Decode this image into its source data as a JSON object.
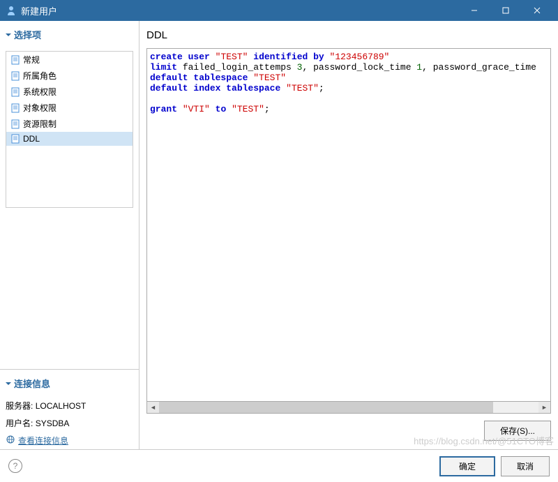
{
  "titlebar": {
    "title": "新建用户"
  },
  "sidebar": {
    "header": "选择项",
    "items": [
      {
        "label": "常规"
      },
      {
        "label": "所属角色"
      },
      {
        "label": "系统权限"
      },
      {
        "label": "对象权限"
      },
      {
        "label": "资源限制"
      },
      {
        "label": "DDL",
        "selected": true
      }
    ]
  },
  "connection": {
    "header": "连接信息",
    "server_label": "服务器:",
    "server_value": "LOCALHOST",
    "user_label": "用户名:",
    "user_value": "SYSDBA",
    "view_link": "查看连接信息"
  },
  "content": {
    "title": "DDL",
    "code_tokens": [
      {
        "t": "kw",
        "v": "create"
      },
      {
        "t": "",
        "v": " "
      },
      {
        "t": "kw",
        "v": "user"
      },
      {
        "t": "",
        "v": " "
      },
      {
        "t": "str",
        "v": "\"TEST\""
      },
      {
        "t": "",
        "v": " "
      },
      {
        "t": "kw",
        "v": "identified"
      },
      {
        "t": "",
        "v": " "
      },
      {
        "t": "kw",
        "v": "by"
      },
      {
        "t": "",
        "v": " "
      },
      {
        "t": "str",
        "v": "\"123456789\""
      },
      {
        "t": "nl",
        "v": ""
      },
      {
        "t": "kw",
        "v": "limit"
      },
      {
        "t": "",
        "v": " failed_login_attemps "
      },
      {
        "t": "num",
        "v": "3"
      },
      {
        "t": "",
        "v": ", password_lock_time "
      },
      {
        "t": "num",
        "v": "1"
      },
      {
        "t": "",
        "v": ", password_grace_time"
      },
      {
        "t": "nl",
        "v": ""
      },
      {
        "t": "kw",
        "v": "default"
      },
      {
        "t": "",
        "v": " "
      },
      {
        "t": "kw",
        "v": "tablespace"
      },
      {
        "t": "",
        "v": " "
      },
      {
        "t": "str",
        "v": "\"TEST\""
      },
      {
        "t": "nl",
        "v": ""
      },
      {
        "t": "kw",
        "v": "default"
      },
      {
        "t": "",
        "v": " "
      },
      {
        "t": "kw",
        "v": "index"
      },
      {
        "t": "",
        "v": " "
      },
      {
        "t": "kw",
        "v": "tablespace"
      },
      {
        "t": "",
        "v": " "
      },
      {
        "t": "str",
        "v": "\"TEST\""
      },
      {
        "t": "",
        "v": ";"
      },
      {
        "t": "nl",
        "v": ""
      },
      {
        "t": "nl",
        "v": ""
      },
      {
        "t": "kw",
        "v": "grant"
      },
      {
        "t": "",
        "v": " "
      },
      {
        "t": "str",
        "v": "\"VTI\""
      },
      {
        "t": "",
        "v": " "
      },
      {
        "t": "kw",
        "v": "to"
      },
      {
        "t": "",
        "v": " "
      },
      {
        "t": "str",
        "v": "\"TEST\""
      },
      {
        "t": "",
        "v": ";"
      }
    ],
    "save_label": "保存(S)..."
  },
  "footer": {
    "ok": "确定",
    "cancel": "取消",
    "help": "?"
  },
  "watermark": "https://blog.csdn.net/@51CTO博客"
}
